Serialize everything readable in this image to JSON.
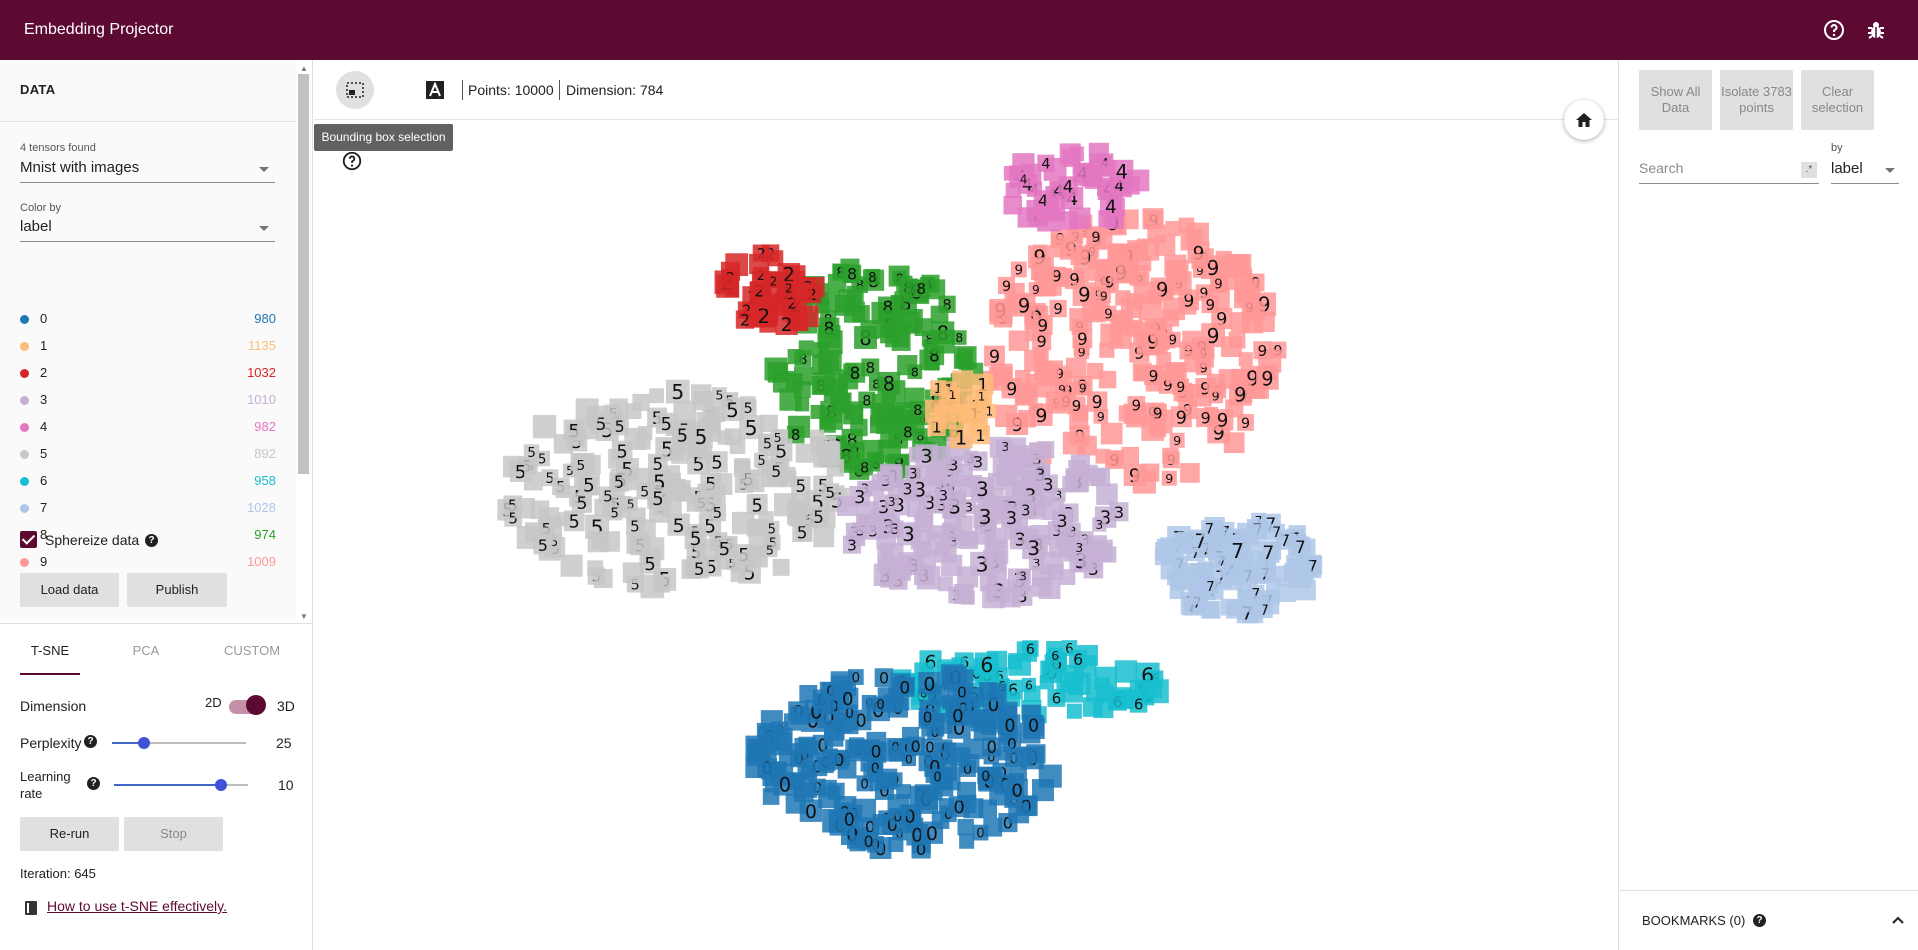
{
  "app": {
    "title": "Embedding Projector"
  },
  "topbar_icons": [
    "help-circle-icon",
    "bug-icon"
  ],
  "data_panel": {
    "section_title": "DATA",
    "tensors_found": "4 tensors found",
    "dataset": "Mnist with images",
    "color_by_label": "Color by",
    "color_by_value": "label",
    "legend": [
      {
        "label": "0",
        "count": "980",
        "color": "#1f77b4"
      },
      {
        "label": "1",
        "count": "1135",
        "color": "#ffbb78"
      },
      {
        "label": "2",
        "count": "1032",
        "color": "#d62728"
      },
      {
        "label": "3",
        "count": "1010",
        "color": "#c5b0d5"
      },
      {
        "label": "4",
        "count": "982",
        "color": "#e377c2"
      },
      {
        "label": "5",
        "count": "892",
        "color": "#c7c7c7"
      },
      {
        "label": "6",
        "count": "958",
        "color": "#17becf"
      },
      {
        "label": "7",
        "count": "1028",
        "color": "#aec7e8"
      },
      {
        "label": "8",
        "count": "974",
        "color": "#2ca02c"
      },
      {
        "label": "9",
        "count": "1009",
        "color": "#ff9896"
      }
    ],
    "sphereize_label": "Sphereize data",
    "load_button": "Load data",
    "publish_button": "Publish"
  },
  "projection": {
    "tabs": [
      "T-SNE",
      "PCA",
      "CUSTOM"
    ],
    "active_tab": "T-SNE",
    "dimension_label": "Dimension",
    "dim_2d": "2D",
    "dim_3d": "3D",
    "perplexity_label": "Perplexity",
    "perplexity_value": "25",
    "perplexity_fraction": 0.24,
    "learning_rate_label_1": "Learning",
    "learning_rate_label_2": "rate",
    "learning_rate_value": "10",
    "learning_rate_fraction": 0.8,
    "rerun_button": "Re-run",
    "stop_button": "Stop",
    "iteration": "Iteration: 645",
    "help_link": "How to use t-SNE effectively."
  },
  "toolbar": {
    "points": "Points: 10000",
    "dimension": "Dimension: 784",
    "tooltip": "Bounding box selection"
  },
  "inspector": {
    "show_all_1": "Show All",
    "show_all_2": "Data",
    "isolate_1": "Isolate 3783",
    "isolate_2": "points",
    "clear_1": "Clear",
    "clear_2": "selection",
    "search_placeholder": "Search",
    "regex_label": ".*",
    "by_label": "by",
    "by_value": "label",
    "bookmarks": "BOOKMARKS (0)"
  }
}
